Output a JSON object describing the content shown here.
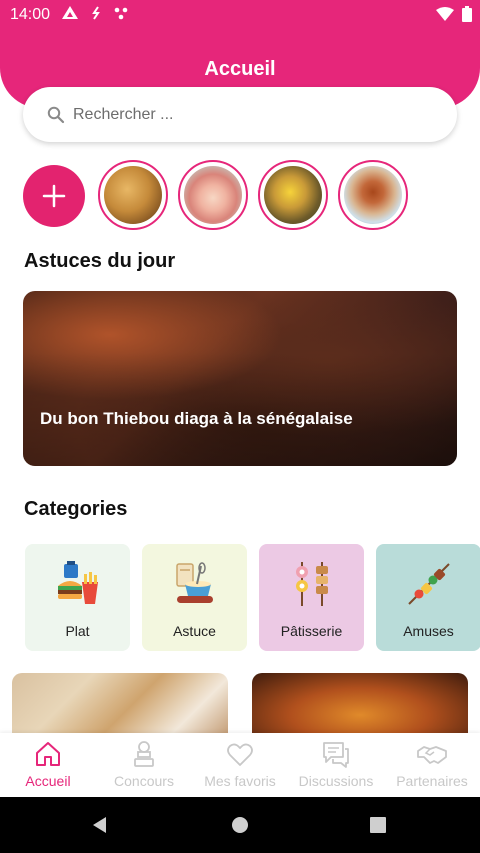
{
  "status_bar": {
    "time": "14:00"
  },
  "header": {
    "title": "Accueil"
  },
  "search": {
    "placeholder": "Rechercher ..."
  },
  "featured": {
    "section_title": "Astuces du jour",
    "caption": "Du bon Thiebou diaga à la sénégalaise"
  },
  "categories": {
    "section_title": "Categories",
    "items": [
      {
        "label": "Plat",
        "bg": "#eef6ee",
        "icon": "burger-fries-icon"
      },
      {
        "label": "Astuce",
        "bg": "#f3f7df",
        "icon": "baking-icon"
      },
      {
        "label": "Pâtisserie",
        "bg": "#ecc9e4",
        "icon": "skewers-icon"
      },
      {
        "label": "Amuses",
        "bg": "#b9dcd9",
        "icon": "kebab-icon"
      }
    ]
  },
  "bottom_nav": {
    "items": [
      {
        "label": "Accueil",
        "icon": "home-icon",
        "active": true
      },
      {
        "label": "Concours",
        "icon": "chef-trophy-icon",
        "active": false
      },
      {
        "label": "Mes favoris",
        "icon": "heart-icon",
        "active": false
      },
      {
        "label": "Discussions",
        "icon": "chat-icon",
        "active": false
      },
      {
        "label": "Partenaires",
        "icon": "handshake-icon",
        "active": false
      }
    ]
  },
  "colors": {
    "accent": "#e6267a",
    "inactive": "#c8c8c8"
  }
}
